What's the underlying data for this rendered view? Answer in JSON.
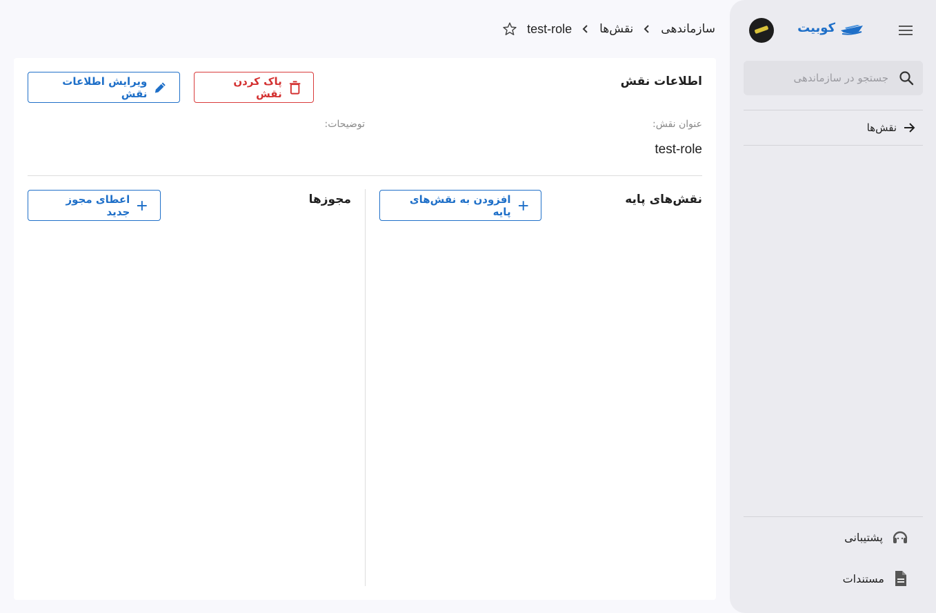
{
  "sidebar": {
    "brand_name": "کوبیت",
    "search_placeholder": "جستجو در سازماندهی",
    "nav_items": [
      {
        "label": "نقش‌ها"
      }
    ],
    "bottom_items": [
      {
        "label": "پشتیبانی",
        "icon": "headset-icon"
      },
      {
        "label": "مستندات",
        "icon": "document-icon"
      }
    ]
  },
  "breadcrumb": {
    "items": [
      "سازماندهی",
      "نقش‌ها",
      "test-role"
    ]
  },
  "role_info": {
    "title": "اطلاعات نقش",
    "delete_label": "پاک کردن نقش",
    "edit_label": "ویرایش اطلاعات نقش",
    "name_label": "عنوان نقش:",
    "name_value": "test-role",
    "description_label": "توضیحات:"
  },
  "base_roles": {
    "title": "نقش‌های پایه",
    "add_label": "افزودن به نقش‌های پایه"
  },
  "permissions": {
    "title": "مجوزها",
    "grant_label": "اعطای مجوز جدید"
  },
  "colors": {
    "primary": "#1e6fc8",
    "danger": "#d33030",
    "sidebar_bg": "#ebebf0",
    "page_bg": "#f8f8fc"
  }
}
